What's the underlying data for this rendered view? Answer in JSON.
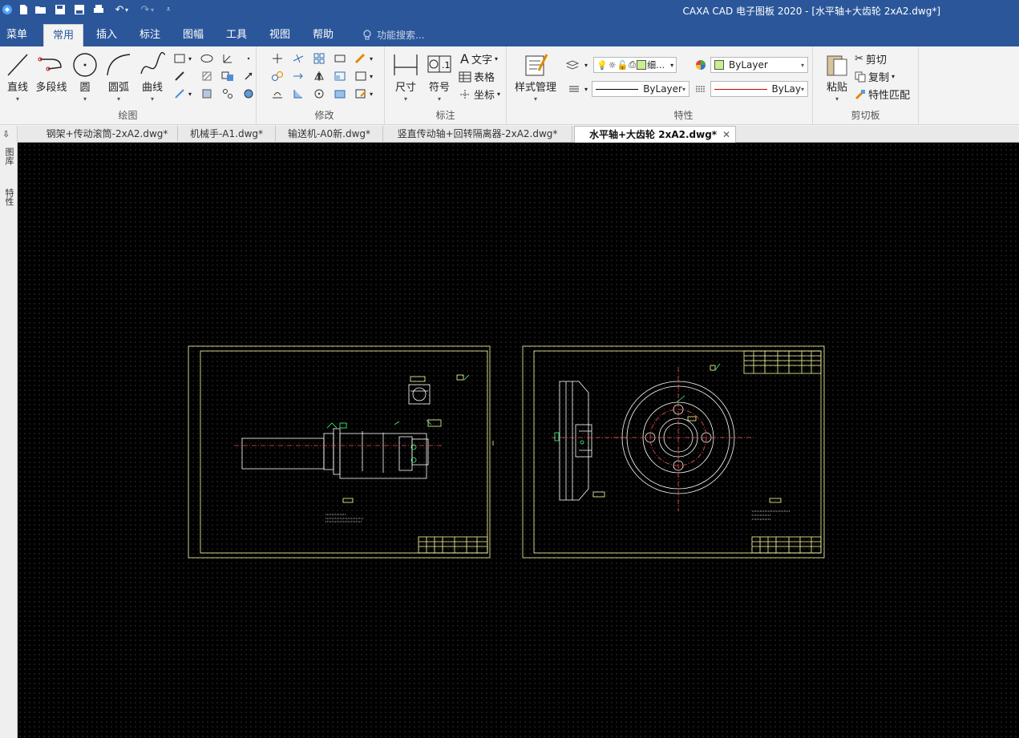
{
  "window": {
    "title": "CAXA CAD 电子图板 2020 - [水平轴+大齿轮 2xA2.dwg*]"
  },
  "quick_access": [
    "new-icon",
    "open-icon",
    "save-icon",
    "save-as-icon",
    "print-icon",
    "undo-icon",
    "redo-icon",
    "customize-icon"
  ],
  "menu": {
    "tabs": [
      "菜单",
      "常用",
      "插入",
      "标注",
      "图幅",
      "工具",
      "视图",
      "帮助"
    ],
    "active": "常用",
    "search_placeholder": "功能搜索..."
  },
  "ribbon": {
    "draw": {
      "label": "绘图",
      "big_buttons": [
        "直线",
        "多段线",
        "圆",
        "圆弧",
        "曲线"
      ]
    },
    "modify": {
      "label": "修改"
    },
    "annotate": {
      "label": "标注",
      "big_buttons": [
        "尺寸",
        "符号"
      ],
      "small_buttons": [
        "文字",
        "表格",
        "坐标"
      ]
    },
    "style": {
      "button": "样式管理"
    },
    "properties": {
      "label": "特性",
      "linewidth_combo": "细…",
      "color_combo": "ByLayer",
      "linetype_combo": "ByLayer",
      "linetype2_combo": "ByLay"
    },
    "clipboard": {
      "label": "剪切板",
      "paste": "粘贴",
      "cut": "剪切",
      "copy": "复制",
      "match": "特性匹配"
    }
  },
  "document_tabs": [
    "钢架+传动滚筒-2xA2.dwg*",
    "机械手-A1.dwg*",
    "输送机-A0新.dwg*",
    "竖直传动轴+回转隔离器-2xA2.dwg*",
    "水平轴+大齿轮 2xA2.dwg*"
  ],
  "active_document": "水平轴+大齿轮 2xA2.dwg*",
  "side_panel": [
    "图库",
    "特性"
  ],
  "colors": {
    "title_bar": "#2b579a",
    "canvas_bg": "#000000",
    "frame_line": "#ffffa0",
    "geometry_line": "#ffffff",
    "dim_line": "#40ff80",
    "center_line": "#ff4040"
  }
}
